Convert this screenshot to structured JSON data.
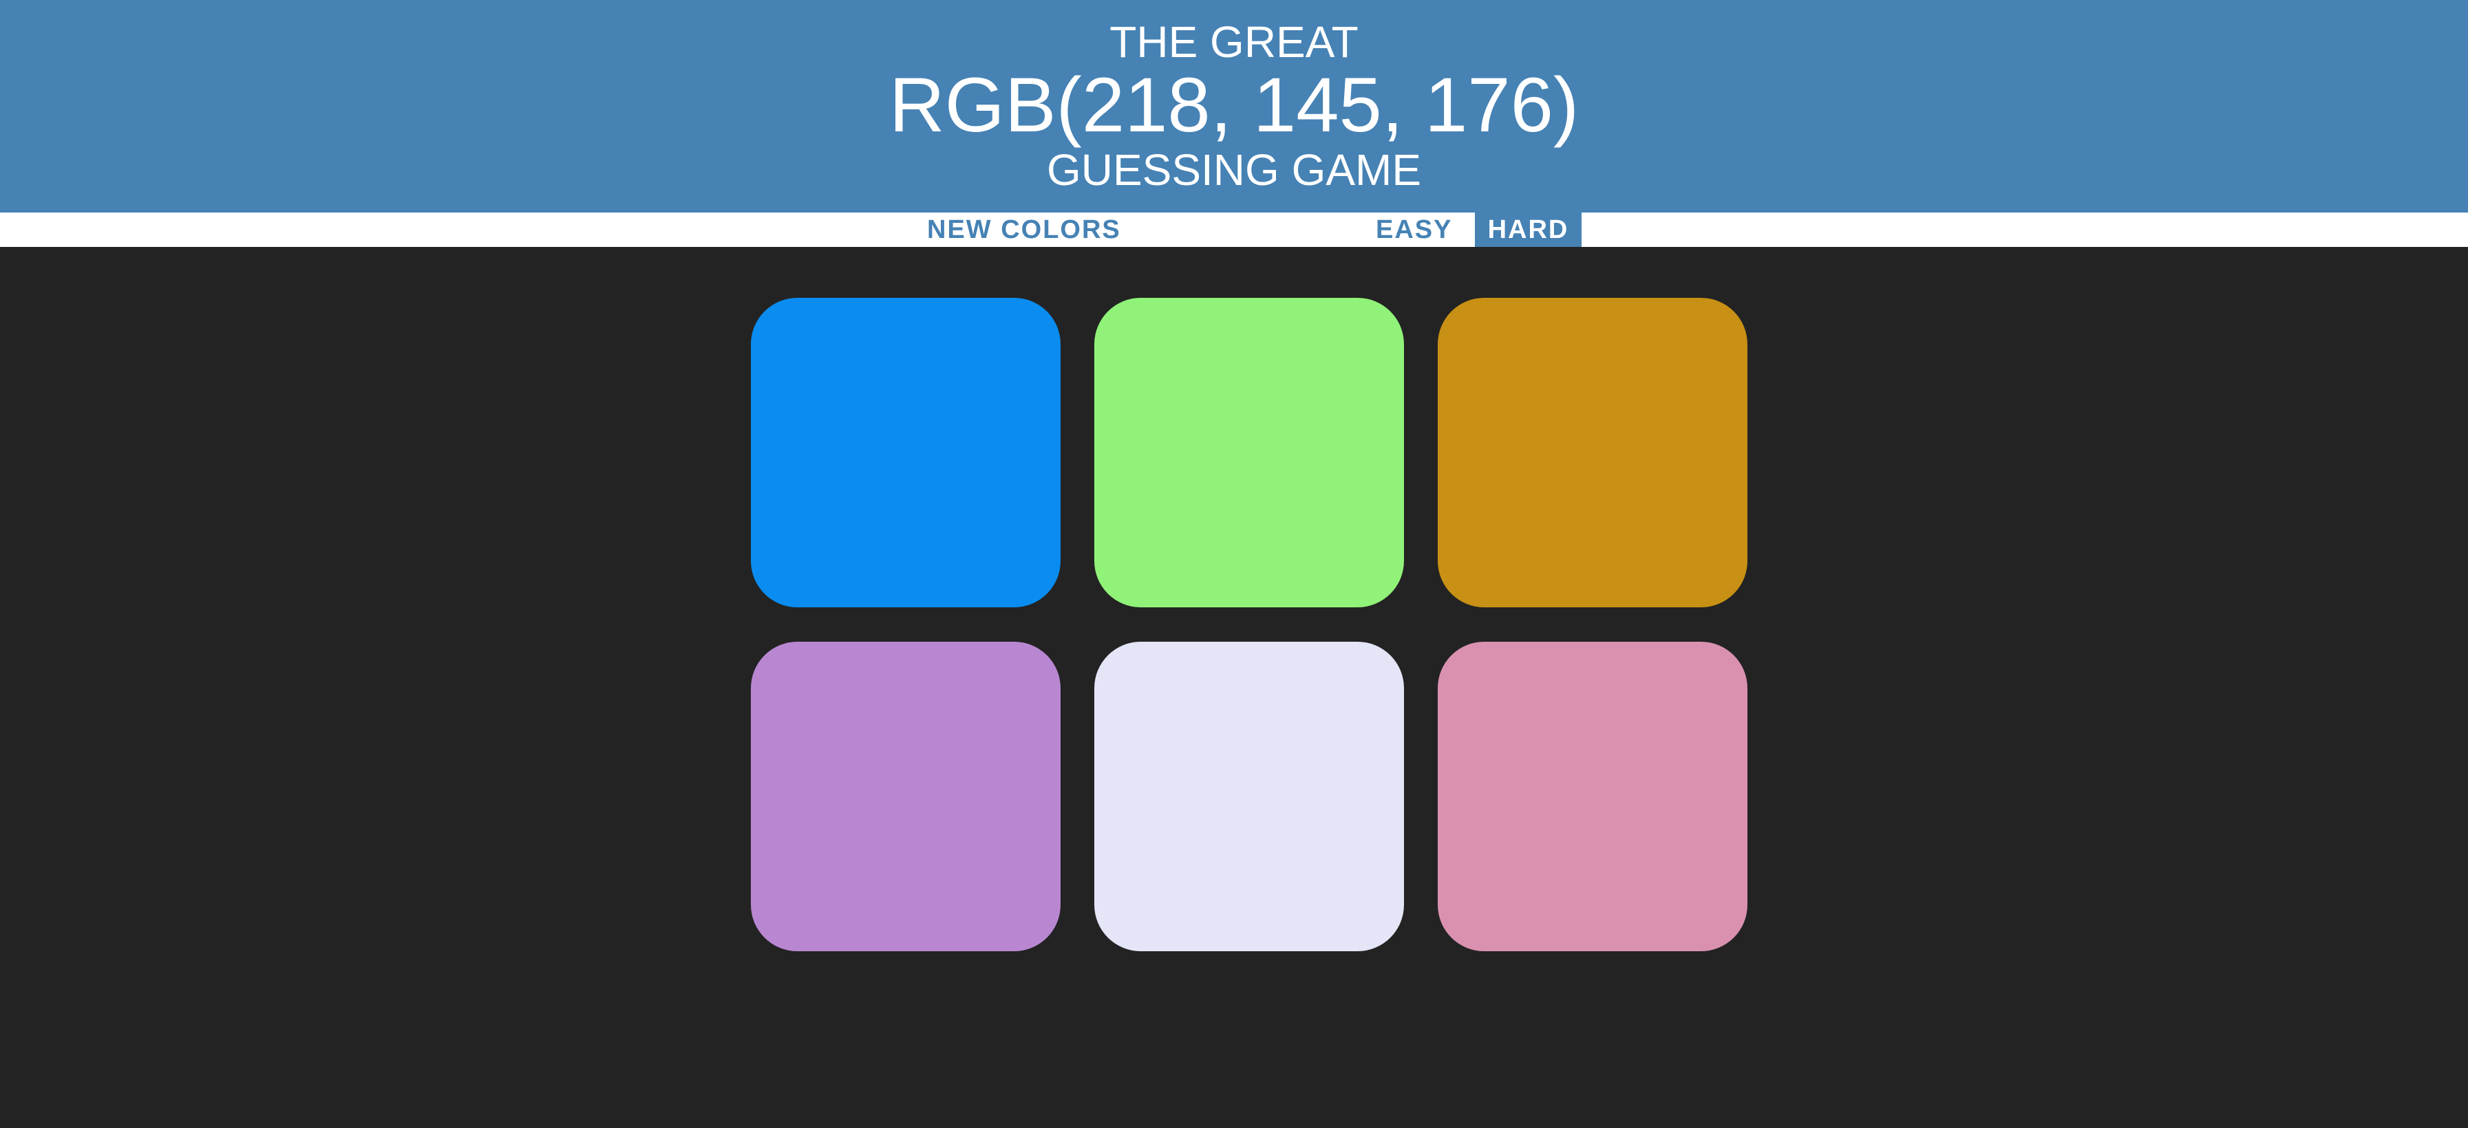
{
  "header": {
    "line1": "The Great",
    "rgb_target": "RGB(218, 145, 176)",
    "line3": "Guessing Game",
    "background": "#4682b4"
  },
  "nav": {
    "new_colors": "New Colors",
    "message": "",
    "easy": "Easy",
    "hard": "Hard",
    "selected_mode": "hard"
  },
  "squares": [
    {
      "color": "#0a8cf0"
    },
    {
      "color": "#90f278"
    },
    {
      "color": "#c89014"
    },
    {
      "color": "#b987d2"
    },
    {
      "color": "#e4e5f7"
    },
    {
      "color": "#da91b0"
    }
  ]
}
